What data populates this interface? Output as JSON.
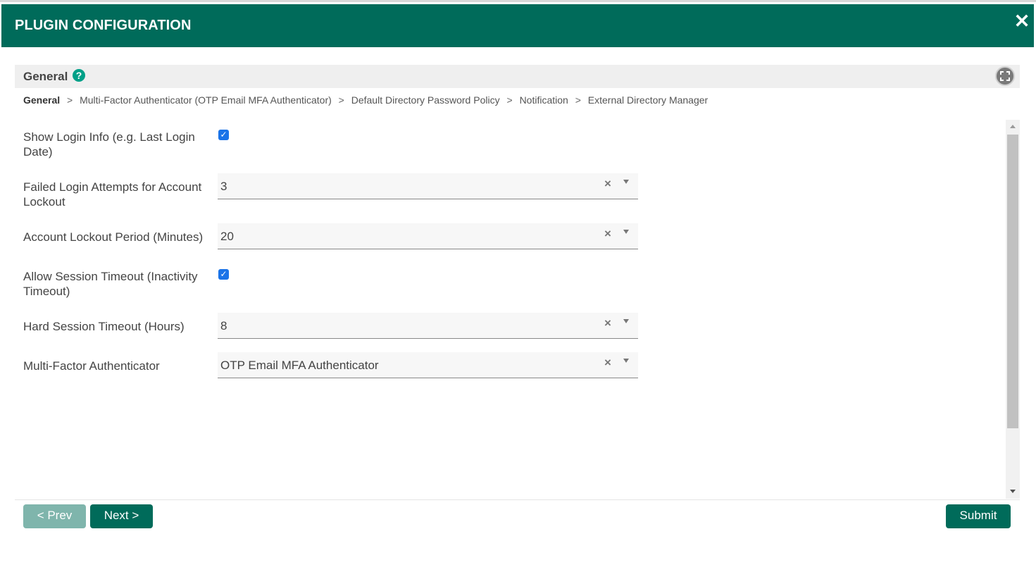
{
  "dialog": {
    "title": "PLUGIN CONFIGURATION",
    "close_glyph": "✕"
  },
  "section": {
    "title": "General",
    "help_glyph": "?"
  },
  "breadcrumb": [
    {
      "label": "General",
      "active": true
    },
    {
      "label": "Multi-Factor Authenticator (OTP Email MFA Authenticator)",
      "active": false
    },
    {
      "label": "Default Directory Password Policy",
      "active": false
    },
    {
      "label": "Notification",
      "active": false
    },
    {
      "label": "External Directory Manager",
      "active": false
    }
  ],
  "breadcrumb_separator": ">",
  "fields": [
    {
      "label": "Show Login Info (e.g. Last Login Date)",
      "type": "checkbox",
      "checked": true
    },
    {
      "label": "Failed Login Attempts for Account Lockout",
      "type": "select",
      "value": "3"
    },
    {
      "label": "Account Lockout Period (Minutes)",
      "type": "select",
      "value": "20"
    },
    {
      "label": "Allow Session Timeout (Inactivity Timeout)",
      "type": "checkbox",
      "checked": true
    },
    {
      "label": "Hard Session Timeout (Hours)",
      "type": "select",
      "value": "8"
    },
    {
      "label": "Multi-Factor Authenticator",
      "type": "select",
      "value": "OTP Email MFA Authenticator"
    }
  ],
  "buttons": {
    "prev": "< Prev",
    "next": "Next >",
    "submit": "Submit"
  },
  "colors": {
    "header": "#006b5a",
    "help_icon": "#00a088",
    "checkbox": "#1a73e8",
    "button_disabled": "#7fb5ac"
  }
}
